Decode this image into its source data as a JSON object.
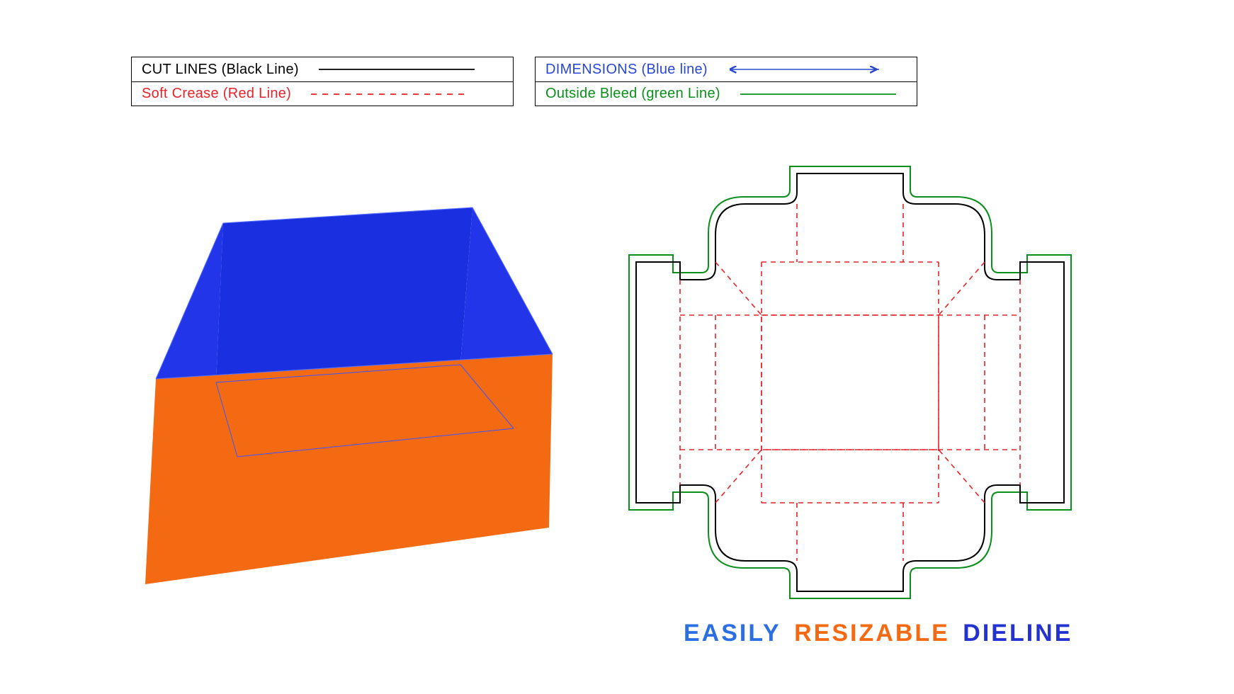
{
  "legend": {
    "left": [
      {
        "label": "CUT LINES (Black Line)",
        "color": "c-black",
        "sample": "solid-black"
      },
      {
        "label": "Soft Crease (Red Line)",
        "color": "c-red",
        "sample": "dashed-red"
      }
    ],
    "right": [
      {
        "label": "DIMENSIONS (Blue line)",
        "color": "c-blue",
        "sample": "arrow-blue"
      },
      {
        "label": "Outside Bleed (green Line)",
        "color": "c-green",
        "sample": "solid-green"
      }
    ]
  },
  "tagline": {
    "w1": "EASILY",
    "w2": "RESIZABLE",
    "w3": "DIELINE"
  },
  "colors": {
    "orange": "#f46a13",
    "blue_inner": "#1a2fe0",
    "blue_dark": "#1420b5",
    "cut": "#000000",
    "crease": "#e6232a",
    "bleed": "#0a8f1a",
    "dim": "#2947d3"
  },
  "diagram": {
    "type": "packaging-dieline",
    "description": "Open tray box dieline with 3D render",
    "line_types": [
      "cut (black solid)",
      "soft crease (red dashed)",
      "outside bleed (green solid)",
      "dimension (blue arrow)"
    ]
  }
}
